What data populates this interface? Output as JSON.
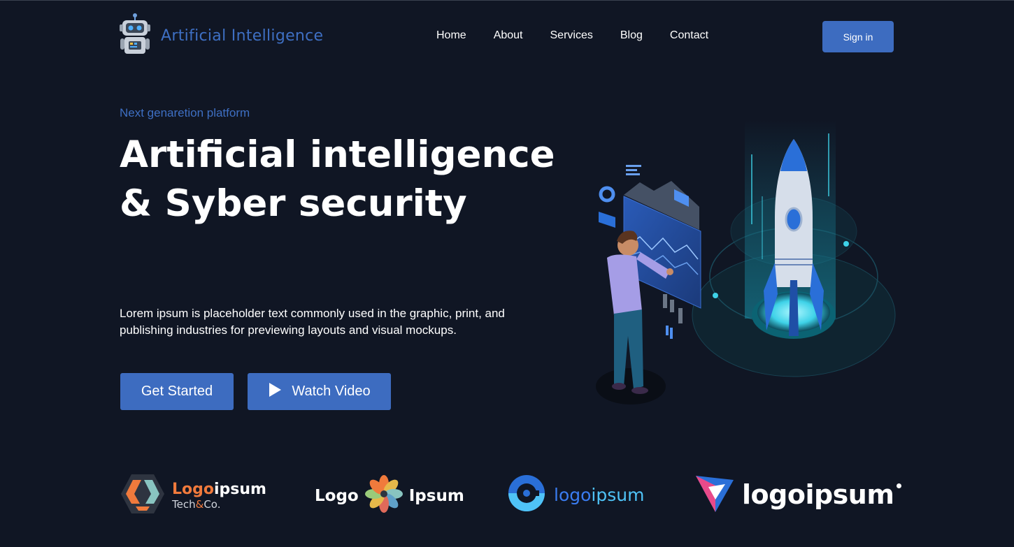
{
  "header": {
    "brand_name": "Artificial Intelligence",
    "brand_icon": "robot-icon",
    "nav": [
      {
        "label": "Home"
      },
      {
        "label": "About"
      },
      {
        "label": "Services"
      },
      {
        "label": "Blog"
      },
      {
        "label": "Contact"
      }
    ],
    "signin_label": "Sign in"
  },
  "hero": {
    "kicker": "Next genaretion platform",
    "title": "Artificial intelligence & Syber security",
    "description": "Lorem ipsum is placeholder text commonly used in the graphic, print, and publishing industries for previewing layouts and visual mockups.",
    "get_started_label": "Get Started",
    "watch_video_label": "Watch Video",
    "watch_icon": "play-icon"
  },
  "logos": {
    "logo1": {
      "main_a": "Logo",
      "main_b": "ipsum",
      "sub_a": "Tech",
      "sub_amp": "&",
      "sub_b": "Co."
    },
    "logo2": {
      "left": "Logo",
      "right": "Ipsum"
    },
    "logo3": {
      "a": "logo",
      "b": "ipsum"
    },
    "logo4": {
      "text": "logoipsum"
    }
  },
  "colors": {
    "background": "#101624",
    "accent": "#3d6cc0",
    "brand_text": "#3e6fc3",
    "logo1_orange": "#f07a3c",
    "logo3_blue": "#3a7cf0"
  }
}
